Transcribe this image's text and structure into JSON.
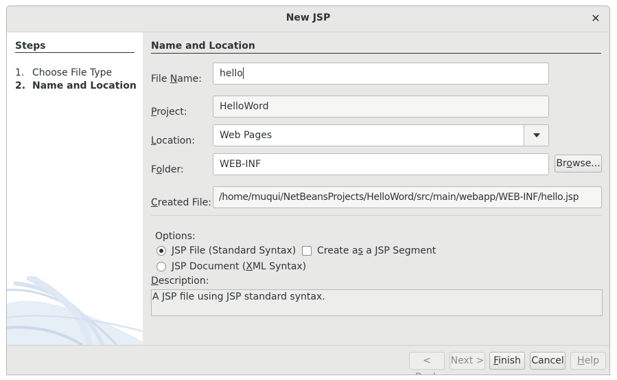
{
  "window": {
    "title": "New JSP"
  },
  "steps": {
    "title": "Steps",
    "items": [
      {
        "num": "1.",
        "label": "Choose File Type"
      },
      {
        "num": "2.",
        "label": "Name and Location"
      }
    ]
  },
  "form": {
    "section_title": "Name and Location",
    "file_name": {
      "label_pre": "File ",
      "label_mn": "N",
      "label_post": "ame:",
      "value": "hello"
    },
    "project": {
      "label_pre": "",
      "label_mn": "P",
      "label_post": "roject:",
      "value": "HelloWord"
    },
    "location": {
      "label_pre": "",
      "label_mn": "L",
      "label_post": "ocation:",
      "value": "Web Pages"
    },
    "folder": {
      "label_pre": "F",
      "label_mn": "o",
      "label_post": "lder:",
      "value": "WEB-INF",
      "browse_pre": "Br",
      "browse_mn": "o",
      "browse_post": "wse..."
    },
    "created_file": {
      "label_pre": "",
      "label_mn": "C",
      "label_post": "reated File:",
      "value": "/home/muqui/NetBeansProjects/HelloWord/src/main/webapp/WEB-INF/hello.jsp"
    },
    "options": {
      "label": "Options:",
      "jsp_file": {
        "label_pre": "",
        "label_mn": "J",
        "label_post": "SP File (Standard Syntax)",
        "selected": true
      },
      "jsp_document": {
        "label_pre": "JSP Document (",
        "label_mn": "X",
        "label_post": "ML Syntax)",
        "selected": false
      },
      "segment": {
        "label_pre": "Create a",
        "label_mn": "s",
        "label_post": " a JSP Segment",
        "checked": false
      }
    },
    "description": {
      "label_pre": "",
      "label_mn": "D",
      "label_post": "escription:",
      "text": "A JSP file using JSP standard syntax."
    }
  },
  "buttons": {
    "back": {
      "pre": "< ",
      "mn": "B",
      "post": "ack",
      "enabled": false
    },
    "next": {
      "pre": "Next >",
      "mn": "",
      "post": "",
      "enabled": false
    },
    "finish": {
      "pre": "",
      "mn": "F",
      "post": "inish",
      "enabled": true
    },
    "cancel": {
      "pre": "Cancel",
      "mn": "",
      "post": "",
      "enabled": true
    },
    "help": {
      "pre": "",
      "mn": "H",
      "post": "elp",
      "enabled": false
    }
  }
}
